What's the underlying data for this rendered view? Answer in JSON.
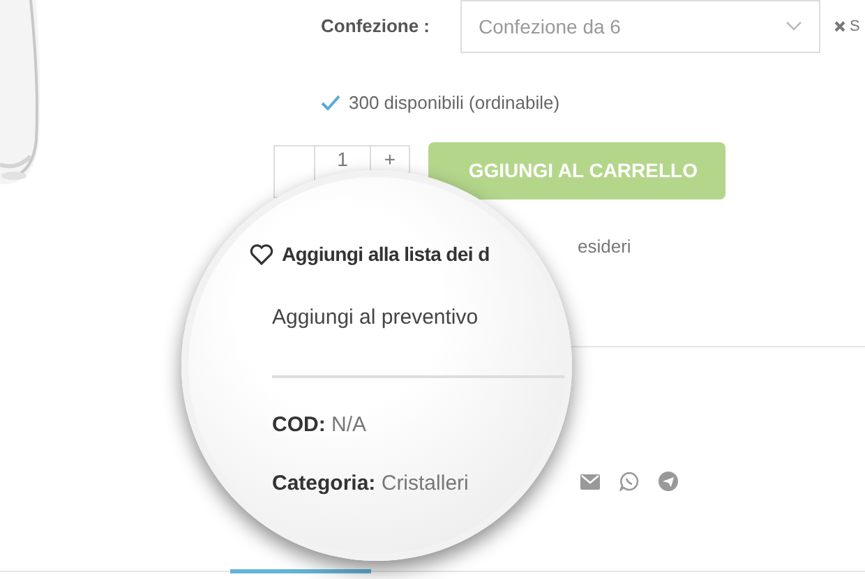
{
  "variation": {
    "label": "Confezione :",
    "value": "Confezione da 6",
    "clear_label": "S"
  },
  "stock": "300 disponibili (ordinabile)",
  "quantity": {
    "value": "1",
    "plus": "+"
  },
  "add_to_cart": "GGIUNGI AL CARRELLO",
  "wishlist_rest": "esideri",
  "magnifier": {
    "wishlist": "Aggiungi alla lista dei d",
    "quote": "Aggiungi al preventivo",
    "meta": [
      {
        "label": "COD:",
        "value": "N/A"
      },
      {
        "label": "Categoria:",
        "value": "Cristalleri"
      }
    ]
  }
}
